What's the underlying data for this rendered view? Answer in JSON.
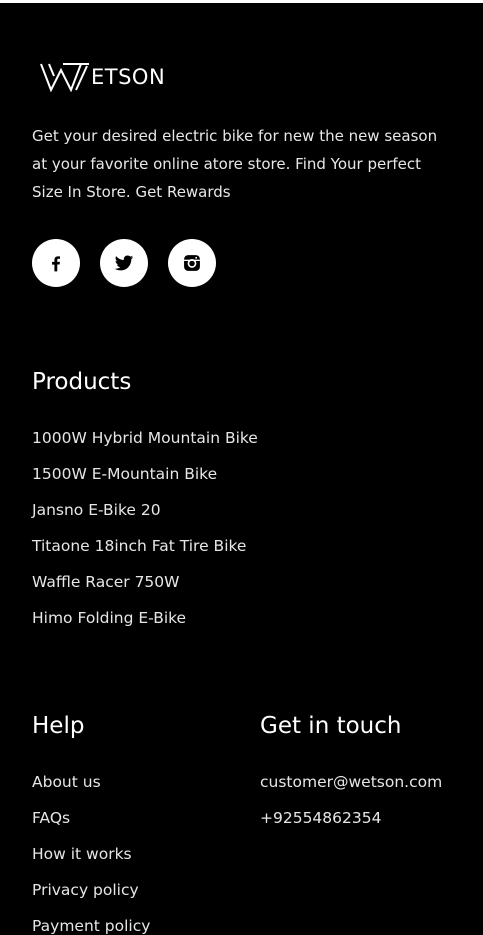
{
  "brand": {
    "logo_text": "ETSON"
  },
  "tagline": "Get your desired electric bike for new the new season at your favorite online atore store. Find Your perfect Size In Store. Get Rewards",
  "socials": [
    {
      "icon": "facebook-icon"
    },
    {
      "icon": "twitter-icon"
    },
    {
      "icon": "instagram-icon"
    }
  ],
  "products": {
    "title": "Products",
    "items": [
      "1000W Hybrid Mountain Bike",
      "1500W E-Mountain Bike",
      "Jansno E-Bike 20",
      "Titaone 18inch Fat Tire Bike",
      "Waffle Racer 750W",
      "Himo Folding E-Bike"
    ]
  },
  "help": {
    "title": "Help",
    "items": [
      "About us",
      "FAQs",
      "How it works",
      "Privacy policy",
      "Payment policy"
    ]
  },
  "contact": {
    "title": "Get in touch",
    "email": "customer@wetson.com",
    "phone": "+92554862354"
  },
  "colors": {
    "background": "#000000",
    "text": "#ffffff",
    "icon_bg": "#ffffff",
    "icon_fg": "#000000"
  }
}
